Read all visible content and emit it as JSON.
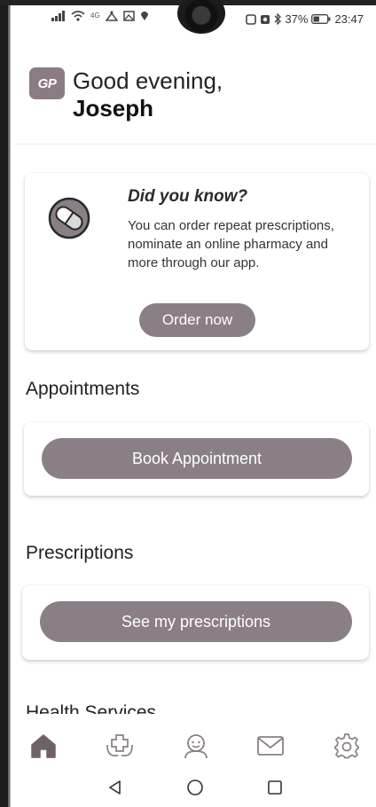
{
  "status_bar": {
    "network_tiny": "4G",
    "battery_percent": "37%",
    "time": "23:47"
  },
  "header": {
    "logo_text": "GP",
    "greeting": "Good evening,",
    "username": "Joseph"
  },
  "info_card": {
    "title": "Did you know?",
    "body": "You can order repeat prescriptions, nominate an online pharmacy and more through our app.",
    "button_label": "Order now"
  },
  "appointments": {
    "title": "Appointments",
    "button_label": "Book Appointment"
  },
  "prescriptions": {
    "title": "Prescriptions",
    "button_label": "See my prescriptions"
  },
  "health_services": {
    "title": "Health Services"
  },
  "bottom_nav": {
    "items": [
      {
        "icon": "home-icon",
        "active": true
      },
      {
        "icon": "health-services-icon",
        "active": false
      },
      {
        "icon": "profile-icon",
        "active": false
      },
      {
        "icon": "messages-icon",
        "active": false
      },
      {
        "icon": "settings-icon",
        "active": false
      }
    ]
  },
  "colors": {
    "accent": "#8a7f86",
    "nav_active": "#6e6268",
    "text": "#222222"
  }
}
